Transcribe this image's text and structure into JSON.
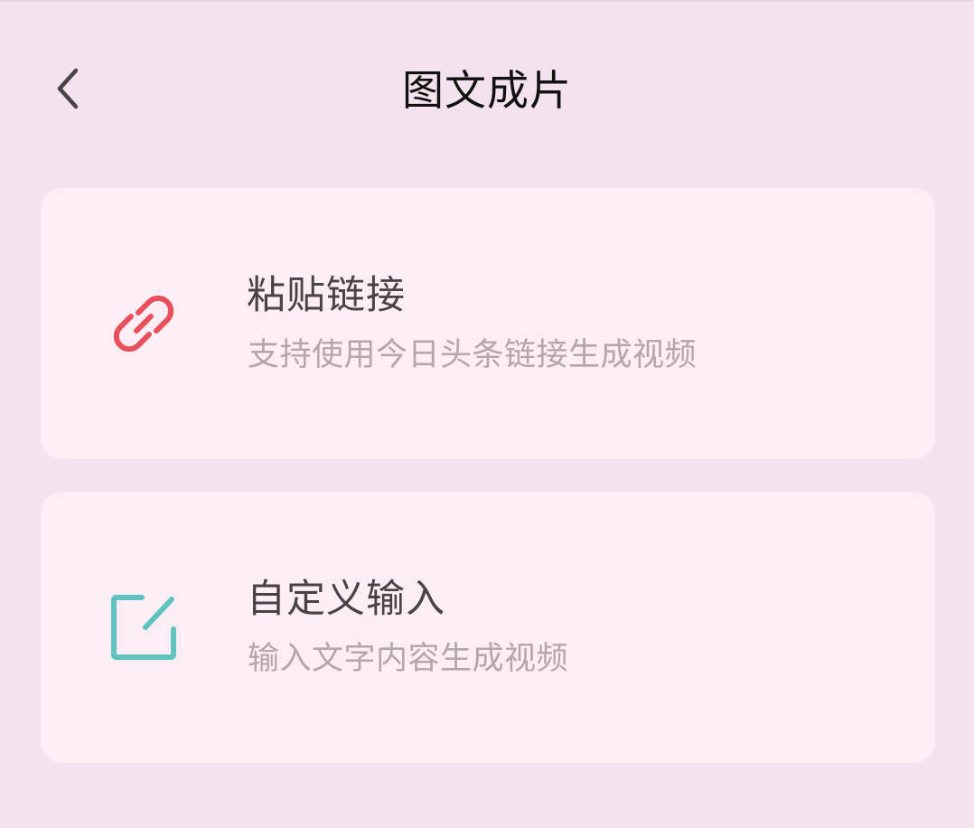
{
  "header": {
    "title": "图文成片",
    "back_icon": "chevron-left-icon"
  },
  "options": [
    {
      "icon": "link-icon",
      "icon_color": "#e8505b",
      "title": "粘贴链接",
      "description": "支持使用今日头条链接生成视频"
    },
    {
      "icon": "edit-icon",
      "icon_color": "#5fc4c0",
      "title": "自定义输入",
      "description": "输入文字内容生成视频"
    }
  ],
  "colors": {
    "background": "#f4e3ee",
    "card": "#fdeef6",
    "title_text": "#111111",
    "option_title": "#4a4345",
    "option_desc": "#b3a6ad"
  }
}
